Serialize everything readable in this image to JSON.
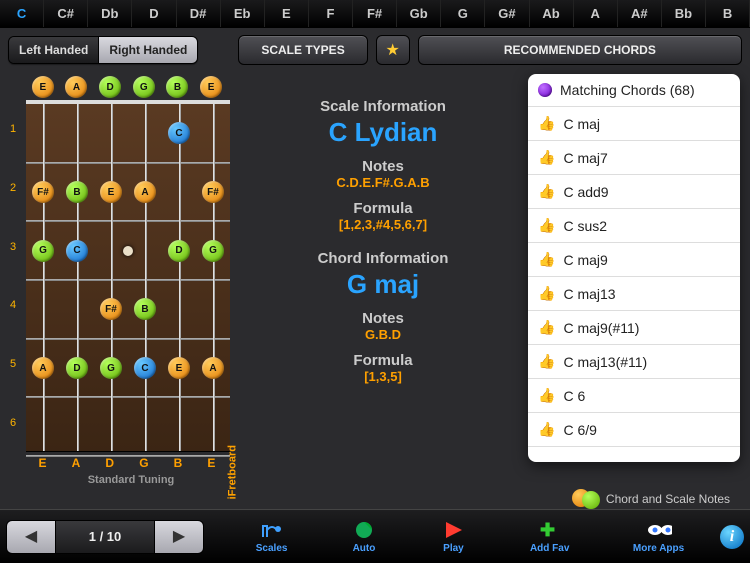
{
  "keys": [
    "C",
    "C#",
    "Db",
    "D",
    "D#",
    "Eb",
    "E",
    "F",
    "F#",
    "Gb",
    "G",
    "G#",
    "Ab",
    "A",
    "A#",
    "Bb",
    "B"
  ],
  "active_key": "C",
  "hand": {
    "left": "Left Handed",
    "right": "Right Handed",
    "active": "right"
  },
  "buttons": {
    "scale_types": "SCALE TYPES",
    "recommended": "RECOMMENDED CHORDS"
  },
  "fretboard": {
    "open_strings": [
      {
        "n": "E",
        "c": "orange"
      },
      {
        "n": "A",
        "c": "orange"
      },
      {
        "n": "D",
        "c": "green"
      },
      {
        "n": "G",
        "c": "green"
      },
      {
        "n": "B",
        "c": "green"
      },
      {
        "n": "E",
        "c": "orange"
      }
    ],
    "labels": [
      "E",
      "A",
      "D",
      "G",
      "B",
      "E"
    ],
    "tuning": "Standard Tuning",
    "brand": "iFretboard",
    "frets": 6,
    "notes": [
      {
        "fret": 1,
        "string": 5,
        "n": "C",
        "c": "blue"
      },
      {
        "fret": 2,
        "string": 1,
        "n": "F#",
        "c": "orange"
      },
      {
        "fret": 2,
        "string": 2,
        "n": "B",
        "c": "green"
      },
      {
        "fret": 2,
        "string": 3,
        "n": "E",
        "c": "orange"
      },
      {
        "fret": 2,
        "string": 4,
        "n": "A",
        "c": "orange"
      },
      {
        "fret": 2,
        "string": 6,
        "n": "F#",
        "c": "orange"
      },
      {
        "fret": 3,
        "string": 1,
        "n": "G",
        "c": "green"
      },
      {
        "fret": 3,
        "string": 2,
        "n": "C",
        "c": "blue"
      },
      {
        "fret": 3,
        "string": 5,
        "n": "D",
        "c": "green"
      },
      {
        "fret": 3,
        "string": 6,
        "n": "G",
        "c": "green"
      },
      {
        "fret": 4,
        "string": 3,
        "n": "F#",
        "c": "orange"
      },
      {
        "fret": 4,
        "string": 4,
        "n": "B",
        "c": "green"
      },
      {
        "fret": 5,
        "string": 1,
        "n": "A",
        "c": "orange"
      },
      {
        "fret": 5,
        "string": 2,
        "n": "D",
        "c": "green"
      },
      {
        "fret": 5,
        "string": 3,
        "n": "G",
        "c": "green"
      },
      {
        "fret": 5,
        "string": 4,
        "n": "C",
        "c": "blue"
      },
      {
        "fret": 5,
        "string": 5,
        "n": "E",
        "c": "orange"
      },
      {
        "fret": 5,
        "string": 6,
        "n": "A",
        "c": "orange"
      }
    ]
  },
  "info": {
    "scale_h": "Scale Information",
    "scale_name": "C Lydian",
    "notes_h": "Notes",
    "scale_notes": "C.D.E.F#.G.A.B",
    "formula_h": "Formula",
    "scale_formula": "[1,2,3,#4,5,6,7]",
    "chord_h": "Chord Information",
    "chord_name": "G maj",
    "chord_notes": "G.B.D",
    "chord_formula": "[1,3,5]"
  },
  "chords": {
    "header": "Matching Chords (68)",
    "items": [
      "C maj",
      "C maj7",
      "C add9",
      "C sus2",
      "C maj9",
      "C maj13",
      "C maj9(#11)",
      "C maj13(#11)",
      "C 6",
      "C 6/9"
    ]
  },
  "legend": "Chord and Scale Notes",
  "pager": {
    "label": "1 / 10"
  },
  "tabs": [
    "Scales",
    "Auto",
    "Play",
    "Add Fav",
    "More Apps"
  ]
}
